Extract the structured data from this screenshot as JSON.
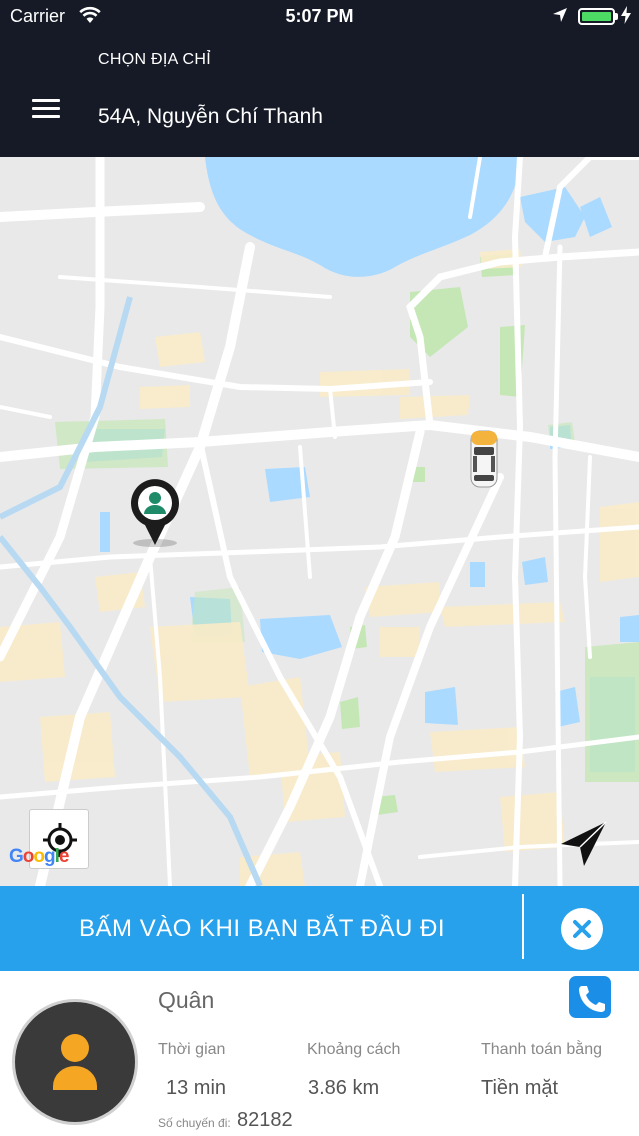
{
  "status_bar": {
    "carrier": "Carrier",
    "time": "5:07 PM"
  },
  "header": {
    "choose_label": "CHỌN ĐỊA CHỈ",
    "address": "54A, Nguyễn Chí Thanh"
  },
  "map": {
    "logo_text": "Google",
    "water_color": "#aadaff",
    "park_color": "#c0e8b0",
    "road_color": "#ffffff",
    "major_road_color": "#fde8b0"
  },
  "start_bar": {
    "label": "BẤM VÀO KHI BẠN BẮT ĐẦU ĐI",
    "color": "#27a1ec"
  },
  "driver": {
    "name": "Quân",
    "time_label": "Thời gian",
    "time_value": "13 min",
    "distance_label": "Khoảng cách",
    "distance_value": "3.86 km",
    "payment_label": "Thanh toán bằng",
    "payment_value": "Tiền mặt",
    "trips_label": "Số chuyến đi:",
    "trips_value": "82182"
  },
  "icons": [
    "wifi-icon",
    "location-arrow-icon",
    "battery-icon",
    "charging-icon",
    "menu-icon",
    "user-pin-icon",
    "taxi-icon",
    "locate-icon",
    "navigate-icon",
    "close-icon",
    "phone-icon",
    "user-avatar-icon"
  ]
}
